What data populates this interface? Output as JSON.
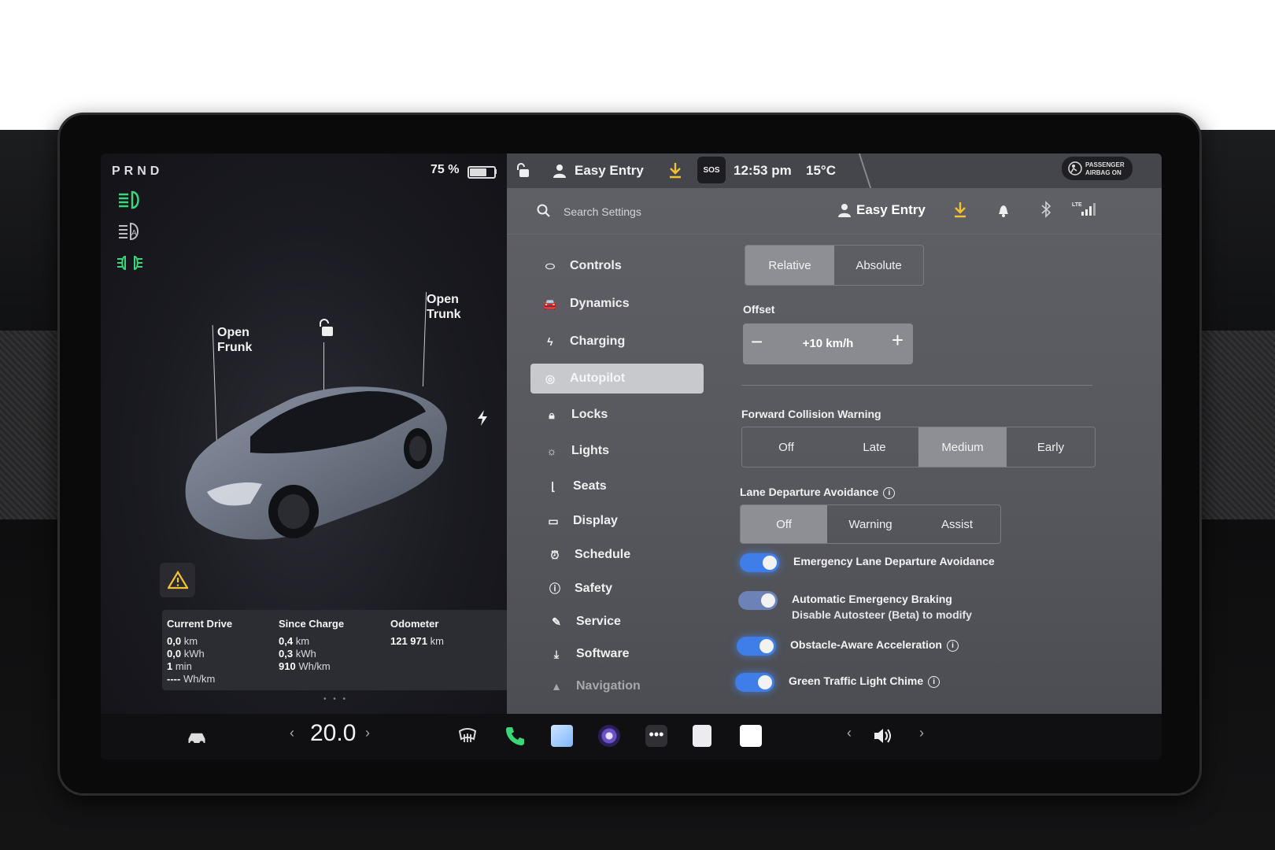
{
  "left": {
    "gear": "PRND",
    "battery_percent": "75 %",
    "battery_level": 0.75,
    "open_frunk": [
      "Open",
      "Frunk"
    ],
    "open_trunk": [
      "Open",
      "Trunk"
    ],
    "trip": {
      "current_drive": {
        "title": "Current Drive",
        "lines": [
          [
            "0,0",
            " km"
          ],
          [
            "0,0",
            " kWh"
          ],
          [
            "1",
            " min"
          ],
          [
            "----",
            " Wh/km"
          ]
        ]
      },
      "since_charge": {
        "title": "Since Charge",
        "lines": [
          [
            "0,4",
            " km"
          ],
          [
            "0,3",
            " kWh"
          ],
          [
            "910",
            " Wh/km"
          ]
        ]
      },
      "odometer": {
        "title": "Odometer",
        "lines": [
          [
            "121 971",
            " km"
          ]
        ]
      }
    },
    "page_dots": "• • •"
  },
  "status_bar": {
    "profile": "Easy Entry",
    "sos": "SOS",
    "time": "12:53 pm",
    "temperature": "15°C",
    "airbag_line1": "PASSENGER",
    "airbag_line2": "AIRBAG ON"
  },
  "settings": {
    "search_placeholder": "Search Settings",
    "profile": "Easy Entry",
    "nav": [
      {
        "label": "Controls",
        "icon": "toggle-icon"
      },
      {
        "label": "Dynamics",
        "icon": "car-icon"
      },
      {
        "label": "Charging",
        "icon": "bolt-icon"
      },
      {
        "label": "Autopilot",
        "icon": "steering-wheel-icon",
        "active": true
      },
      {
        "label": "Locks",
        "icon": "lock-icon"
      },
      {
        "label": "Lights",
        "icon": "sun-icon"
      },
      {
        "label": "Seats",
        "icon": "seat-icon"
      },
      {
        "label": "Display",
        "icon": "display-icon"
      },
      {
        "label": "Schedule",
        "icon": "alarm-icon"
      },
      {
        "label": "Safety",
        "icon": "alert-icon"
      },
      {
        "label": "Service",
        "icon": "wrench-icon"
      },
      {
        "label": "Software",
        "icon": "download-icon"
      },
      {
        "label": "Navigation",
        "icon": "navigation-icon"
      }
    ],
    "speed_mode": {
      "options": [
        "Relative",
        "Absolute"
      ],
      "selected": "Relative"
    },
    "offset": {
      "label": "Offset",
      "value": "+10 km/h",
      "minus": "−",
      "plus": "+"
    },
    "fcw": {
      "label": "Forward Collision Warning",
      "options": [
        "Off",
        "Late",
        "Medium",
        "Early"
      ],
      "selected": "Medium"
    },
    "lda": {
      "label": "Lane Departure Avoidance",
      "options": [
        "Off",
        "Warning",
        "Assist"
      ],
      "selected": "Off"
    },
    "toggles": [
      {
        "label": "Emergency Lane Departure Avoidance",
        "on": true
      },
      {
        "label": "Automatic Emergency Braking",
        "sub": "Disable Autosteer (Beta) to modify",
        "on": true,
        "disabled": true
      },
      {
        "label": "Obstacle-Aware Acceleration",
        "on": true,
        "info": true
      },
      {
        "label": "Green Traffic Light Chime",
        "on": true,
        "info": true
      }
    ]
  },
  "bottom": {
    "temperature_setpoint": "20.0",
    "left_arrow": "‹",
    "right_arrow": "›"
  },
  "colors": {
    "accent_blue": "#3f7ee9",
    "headlight_green": "#39d67a",
    "download_yellow": "#f2c230"
  }
}
